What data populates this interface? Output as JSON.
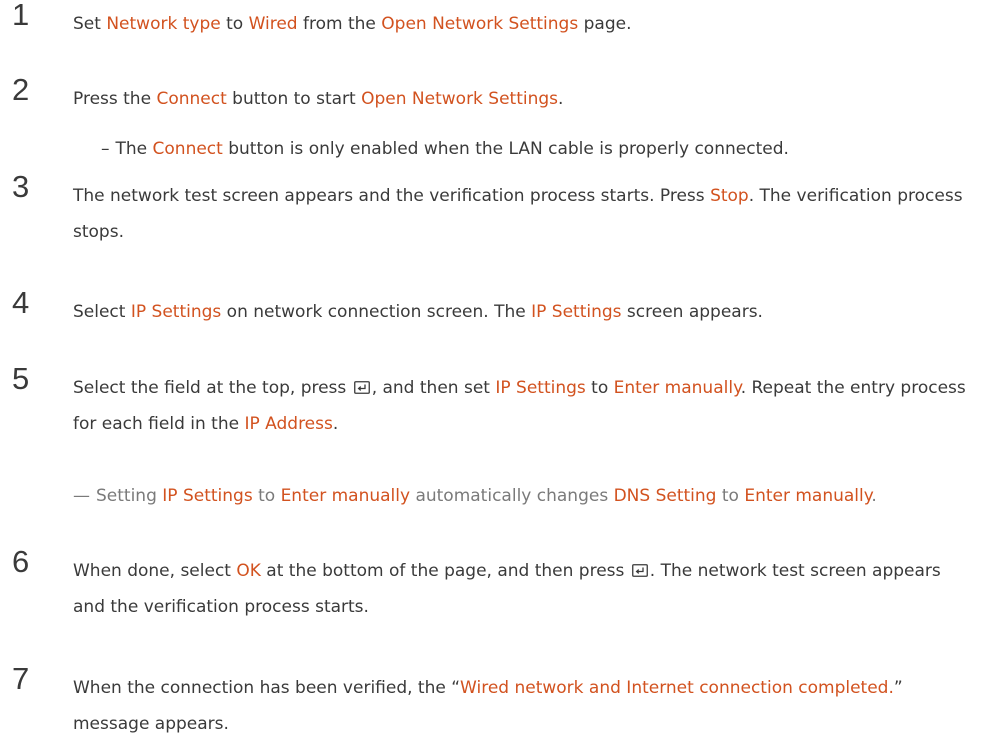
{
  "steps": [
    {
      "number": "1",
      "p1": "Set ",
      "h1": "Network type",
      "p2": " to ",
      "h2": "Wired",
      "p3": " from the ",
      "h3": "Open Network Settings",
      "p4": " page."
    },
    {
      "number": "2",
      "p1": "Press the ",
      "h1": "Connect",
      "p2": " button to start ",
      "h2": "Open Network Settings",
      "p3": "."
    },
    {
      "number": "3",
      "p1": "The network test screen appears and the verification process starts. Press ",
      "h1": "Stop",
      "p2": ". The verification process stops."
    },
    {
      "number": "4",
      "p1": "Select ",
      "h1": "IP Settings",
      "p2": " on network connection screen. The ",
      "h2": "IP Settings",
      "p3": " screen appears."
    },
    {
      "number": "5",
      "p1": "Select the field at the top, press ",
      "p2": ", and then set ",
      "h1": "IP Settings",
      "p3": " to ",
      "h2": "Enter manually",
      "p4": ". Repeat the entry process for each field in the ",
      "h3": "IP Address",
      "p5": "."
    },
    {
      "number": "6",
      "p1": "When done, select ",
      "h1": "OK",
      "p2": " at the bottom of the page, and then press ",
      "p3": ". The network test screen appears and the verification process starts."
    },
    {
      "number": "7",
      "p1": "When the connection has been verified, the “",
      "h1": "Wired network and Internet connection completed.",
      "p2": "” message appears."
    }
  ],
  "sub_note": {
    "dash": "–",
    "p1": "The ",
    "h1": "Connect",
    "p2": " button is only enabled when the LAN cable is properly connected."
  },
  "note": {
    "dash": "—",
    "p1": "Setting ",
    "h1": "IP Settings",
    "p2": " to ",
    "h2": "Enter manually",
    "p3": " automatically changes ",
    "h3": "DNS Setting",
    "p4": " to ",
    "h4": "Enter manually",
    "p5": "."
  },
  "icons": {
    "enter": "enter-key-icon"
  },
  "colors": {
    "highlight": "#d2521f",
    "text": "#3a3a3a",
    "note": "#7a7a7a"
  }
}
